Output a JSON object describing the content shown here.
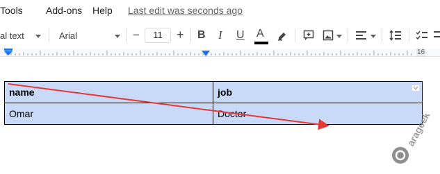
{
  "menu": {
    "items": [
      "Tools",
      "Add-ons",
      "Help"
    ],
    "last_edit": "Last edit was seconds ago"
  },
  "toolbar": {
    "style_label": "al text",
    "font_label": "Arial",
    "font_size": "11",
    "minus_label": "−",
    "plus_label": "+",
    "bold_label": "B",
    "italic_label": "I",
    "underline_label": "U",
    "text_color_label": "A",
    "text_color": "#000000"
  },
  "ruler": {
    "label": "16"
  },
  "table": {
    "header": [
      "name",
      "job"
    ],
    "rows": [
      [
        "Omar",
        "Doctor"
      ]
    ],
    "cell_color": "#c9daf8"
  },
  "annotation": {
    "arrow_color": "#e53935"
  },
  "watermark": {
    "text": "arageek"
  }
}
